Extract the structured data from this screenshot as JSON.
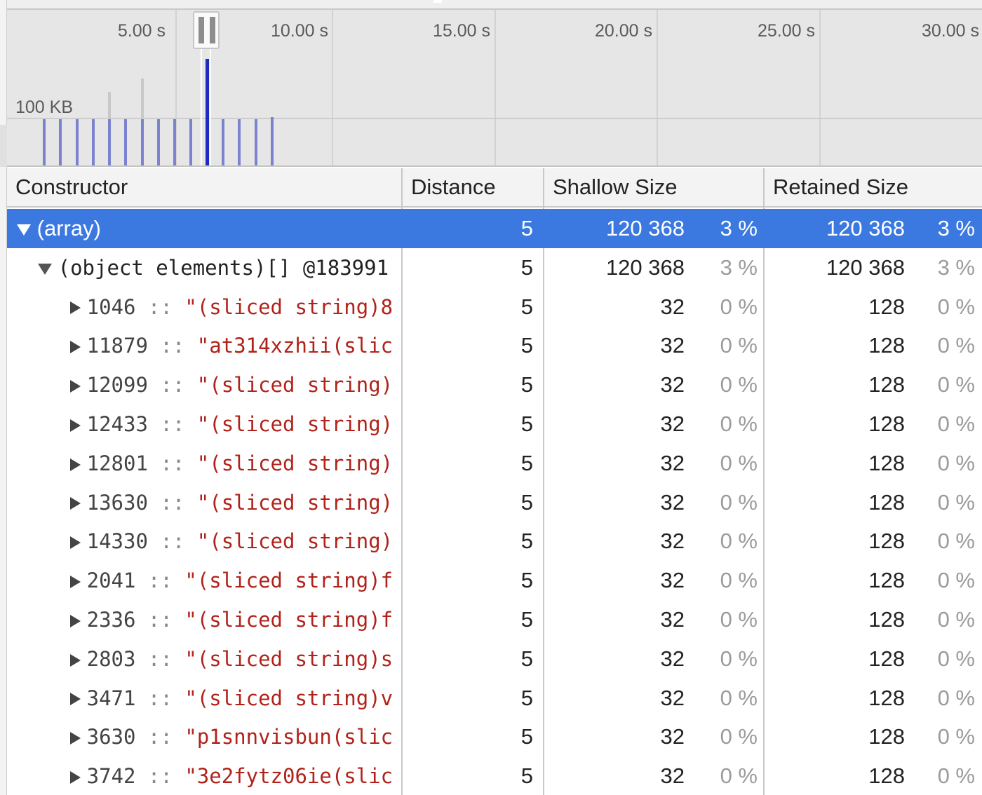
{
  "timeline": {
    "ticks": [
      "5.00 s",
      "10.00 s",
      "15.00 s",
      "20.00 s",
      "25.00 s",
      "30.00 s"
    ],
    "memory_label": "100 KB"
  },
  "table": {
    "columns": [
      "Constructor",
      "Distance",
      "Shallow Size",
      "Retained Size"
    ],
    "root": {
      "name": "(array)",
      "distance": "5",
      "shallow_size": "120 368",
      "shallow_pct": "3 %",
      "retained_size": "120 368",
      "retained_pct": "3 %"
    },
    "child": {
      "name": "(object elements)[] @183991",
      "distance": "5",
      "shallow_size": "120 368",
      "shallow_pct": "3 %",
      "retained_size": "120 368",
      "retained_pct": "3 %"
    },
    "items": [
      {
        "index": "1046",
        "value": "\"(sliced string)8",
        "distance": "5",
        "shallow_size": "32",
        "shallow_pct": "0 %",
        "retained_size": "128",
        "retained_pct": "0 %"
      },
      {
        "index": "11879",
        "value": "\"at314xzhii(slic",
        "distance": "5",
        "shallow_size": "32",
        "shallow_pct": "0 %",
        "retained_size": "128",
        "retained_pct": "0 %"
      },
      {
        "index": "12099",
        "value": "\"(sliced string)",
        "distance": "5",
        "shallow_size": "32",
        "shallow_pct": "0 %",
        "retained_size": "128",
        "retained_pct": "0 %"
      },
      {
        "index": "12433",
        "value": "\"(sliced string)",
        "distance": "5",
        "shallow_size": "32",
        "shallow_pct": "0 %",
        "retained_size": "128",
        "retained_pct": "0 %"
      },
      {
        "index": "12801",
        "value": "\"(sliced string)",
        "distance": "5",
        "shallow_size": "32",
        "shallow_pct": "0 %",
        "retained_size": "128",
        "retained_pct": "0 %"
      },
      {
        "index": "13630",
        "value": "\"(sliced string)",
        "distance": "5",
        "shallow_size": "32",
        "shallow_pct": "0 %",
        "retained_size": "128",
        "retained_pct": "0 %"
      },
      {
        "index": "14330",
        "value": "\"(sliced string)",
        "distance": "5",
        "shallow_size": "32",
        "shallow_pct": "0 %",
        "retained_size": "128",
        "retained_pct": "0 %"
      },
      {
        "index": "2041",
        "value": "\"(sliced string)f",
        "distance": "5",
        "shallow_size": "32",
        "shallow_pct": "0 %",
        "retained_size": "128",
        "retained_pct": "0 %"
      },
      {
        "index": "2336",
        "value": "\"(sliced string)f",
        "distance": "5",
        "shallow_size": "32",
        "shallow_pct": "0 %",
        "retained_size": "128",
        "retained_pct": "0 %"
      },
      {
        "index": "2803",
        "value": "\"(sliced string)s",
        "distance": "5",
        "shallow_size": "32",
        "shallow_pct": "0 %",
        "retained_size": "128",
        "retained_pct": "0 %"
      },
      {
        "index": "3471",
        "value": "\"(sliced string)v",
        "distance": "5",
        "shallow_size": "32",
        "shallow_pct": "0 %",
        "retained_size": "128",
        "retained_pct": "0 %"
      },
      {
        "index": "3630",
        "value": "\"p1snnvisbun(slic",
        "distance": "5",
        "shallow_size": "32",
        "shallow_pct": "0 %",
        "retained_size": "128",
        "retained_pct": "0 %"
      },
      {
        "index": "3742",
        "value": "\"3e2fytz06ie(slic",
        "distance": "5",
        "shallow_size": "32",
        "shallow_pct": "0 %",
        "retained_size": "128",
        "retained_pct": "0 %"
      }
    ]
  },
  "colors": {
    "selection": "#3b78e0",
    "allocation_bar": "#7c82cf",
    "selected_bar": "#1d2bc5",
    "string_value": "#b1221a"
  }
}
